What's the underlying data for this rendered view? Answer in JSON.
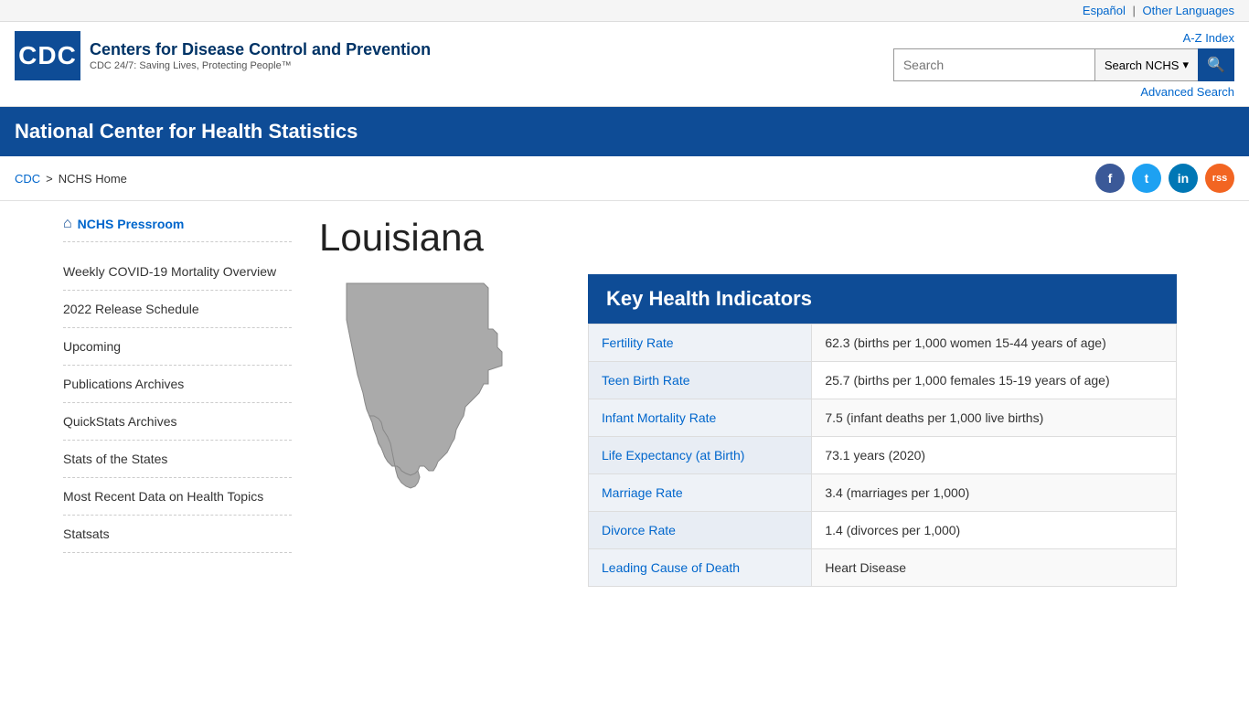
{
  "top_bar": {
    "espanol_label": "Español",
    "separator": "|",
    "other_languages_label": "Other Languages"
  },
  "header": {
    "cdc_acronym": "CDC",
    "org_name": "Centers for Disease Control and Prevention",
    "org_tagline": "CDC 24/7: Saving Lives, Protecting People™",
    "az_index_label": "A-Z Index",
    "search_placeholder": "Search",
    "search_scope_label": "Search NCHS",
    "search_btn_icon": "🔍",
    "advanced_search_label": "Advanced Search"
  },
  "blue_nav": {
    "title": "National Center for Health Statistics"
  },
  "breadcrumb": {
    "cdc_label": "CDC",
    "separator": ">",
    "current_label": "NCHS Home"
  },
  "social": {
    "facebook_label": "f",
    "twitter_label": "t",
    "linkedin_label": "in",
    "rss_label": "rss"
  },
  "sidebar": {
    "home_label": "NCHS Pressroom",
    "items": [
      {
        "label": "Weekly COVID-19 Mortality Overview"
      },
      {
        "label": "2022 Release Schedule"
      },
      {
        "label": "Upcoming"
      },
      {
        "label": "Publications Archives"
      },
      {
        "label": "QuickStats Archives"
      },
      {
        "label": "Stats of the States"
      },
      {
        "label": "Most Recent Data on Health Topics"
      },
      {
        "label": "Statsats"
      }
    ]
  },
  "main": {
    "state_title": "Louisiana",
    "indicators_title": "Key Health Indicators",
    "indicators": [
      {
        "label": "Fertility Rate",
        "value": "62.3 (births per 1,000 women 15-44 years of age)"
      },
      {
        "label": "Teen Birth Rate",
        "value": "25.7 (births per 1,000 females 15-19 years of age)"
      },
      {
        "label": "Infant Mortality Rate",
        "value": "7.5 (infant deaths per 1,000 live births)"
      },
      {
        "label": "Life Expectancy (at Birth)",
        "value": "73.1 years (2020)"
      },
      {
        "label": "Marriage Rate",
        "value": "3.4 (marriages per 1,000)"
      },
      {
        "label": "Divorce Rate",
        "value": "1.4 (divorces per 1,000)"
      },
      {
        "label": "Leading Cause of Death",
        "value": "Heart Disease"
      }
    ]
  }
}
